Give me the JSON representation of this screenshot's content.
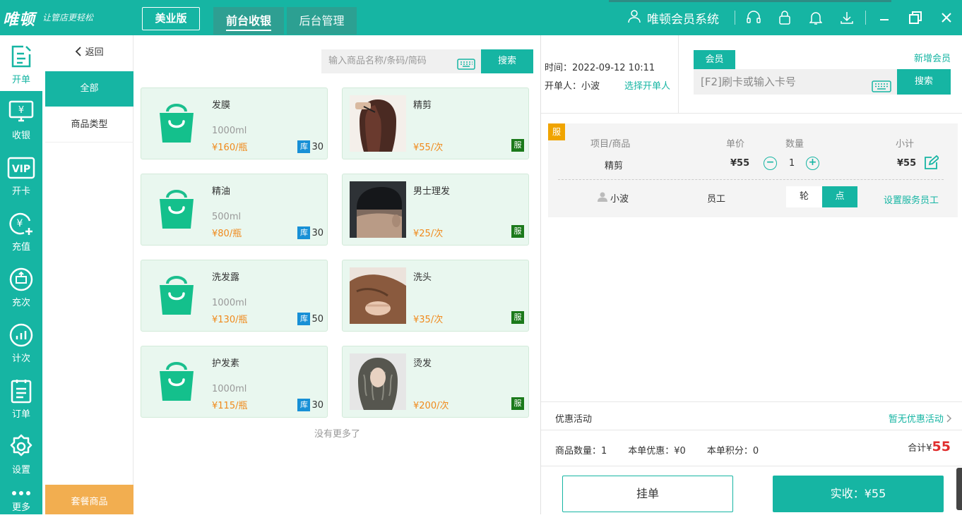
{
  "app": {
    "logo": "唯顿",
    "slogan": "让管店更轻松",
    "edition": "美业版",
    "tabs": [
      "前台收银",
      "后台管理"
    ],
    "system_name": "唯顿会员系统"
  },
  "sidebar": {
    "items": [
      {
        "label": "开单",
        "icon": "edit-icon"
      },
      {
        "label": "收银",
        "icon": "cashier-icon"
      },
      {
        "label": "开卡",
        "icon": "vip-icon"
      },
      {
        "label": "充值",
        "icon": "recharge-icon"
      },
      {
        "label": "充次",
        "icon": "refill-times-icon"
      },
      {
        "label": "计次",
        "icon": "count-icon"
      },
      {
        "label": "订单",
        "icon": "order-icon"
      },
      {
        "label": "设置",
        "icon": "gear-icon"
      },
      {
        "label": "更多",
        "icon": "more-icon"
      }
    ]
  },
  "categories": {
    "back": "返回",
    "all": "全部",
    "type": "商品类型",
    "package": "套餐商品"
  },
  "product_search": {
    "placeholder": "输入商品名称/条码/简码",
    "button": "搜索"
  },
  "products": [
    {
      "name": "发膜",
      "spec": "1000ml",
      "price": "¥160/瓶",
      "kind": "goods",
      "stock_badge": "库",
      "stock": "30"
    },
    {
      "name": "精剪",
      "spec": "",
      "price": "¥55/次",
      "kind": "service",
      "badge": "服"
    },
    {
      "name": "精油",
      "spec": "500ml",
      "price": "¥80/瓶",
      "kind": "goods",
      "stock_badge": "库",
      "stock": "30"
    },
    {
      "name": "男士理发",
      "spec": "",
      "price": "¥25/次",
      "kind": "service",
      "badge": "服"
    },
    {
      "name": "洗发露",
      "spec": "1000ml",
      "price": "¥130/瓶",
      "kind": "goods",
      "stock_badge": "库",
      "stock": "50"
    },
    {
      "name": "洗头",
      "spec": "",
      "price": "¥35/次",
      "kind": "service",
      "badge": "服"
    },
    {
      "name": "护发素",
      "spec": "1000ml",
      "price": "¥115/瓶",
      "kind": "goods",
      "stock_badge": "库",
      "stock": "30"
    },
    {
      "name": "烫发",
      "spec": "",
      "price": "¥200/次",
      "kind": "service",
      "badge": "服"
    }
  ],
  "no_more": "没有更多了",
  "order_info": {
    "time": "时间：2022-09-12 10:11",
    "opener": "开单人：小波",
    "choose_opener": "选择开单人"
  },
  "member": {
    "tab": "会员",
    "new_member": "新增会员",
    "placeholder": "[F2]刷卡或输入卡号",
    "button": "搜索"
  },
  "order": {
    "tag": "服",
    "headers": {
      "item": "项目/商品",
      "price": "单价",
      "qty": "数量",
      "subtotal": "小计"
    },
    "line": {
      "item": "精剪",
      "price": "¥55",
      "qty": "1",
      "subtotal": "¥55"
    },
    "staff_name": "小波",
    "staff_role": "员工",
    "turn": "轮",
    "point": "点",
    "set_staff": "设置服务员工"
  },
  "summary": {
    "promo_label": "优惠活动",
    "promo_value": "暂无优惠活动",
    "count": "商品数量：1",
    "discount": "本单优惠：¥0",
    "points": "本单积分：0",
    "total_label": "合计¥",
    "total_value": "55"
  },
  "actions": {
    "hold": "挂单",
    "pay": "实收：¥55"
  },
  "colors": {
    "accent": "#16b5a3",
    "price": "#f08a1c",
    "total": "#e02d2d",
    "package": "#f2ae50"
  }
}
